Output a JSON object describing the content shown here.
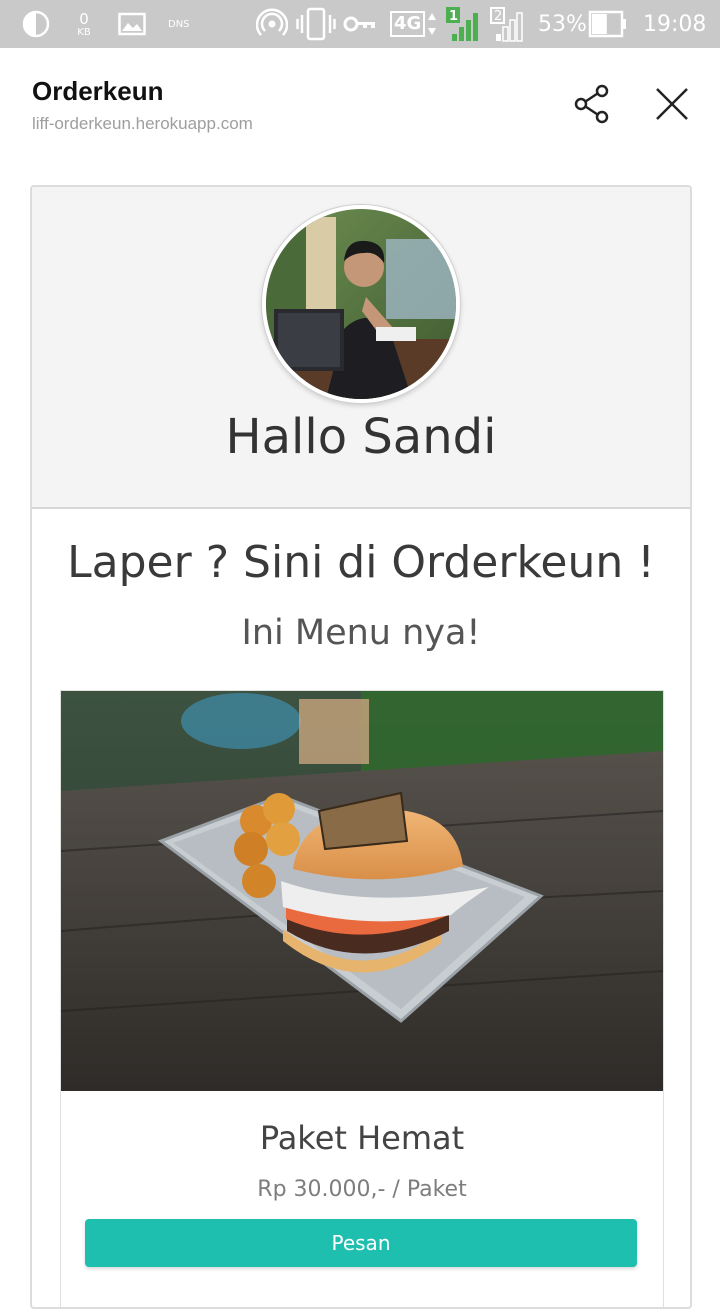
{
  "status_bar": {
    "data_speed_value": "0",
    "data_speed_unit": "KB",
    "dns_label": "DNS",
    "network_type": "4G",
    "sim1_label": "1",
    "sim2_label": "2",
    "battery_percent": "53%",
    "battery_level": 0.53,
    "time": "19:08",
    "icons": [
      "contrast-icon",
      "gallery-icon",
      "hotspot-icon",
      "vibrate-icon",
      "vpn-key-icon",
      "signal-icon",
      "battery-icon"
    ]
  },
  "header": {
    "title": "Orderkeun",
    "url": "liff-orderkeun.herokuapp.com",
    "icons": [
      "share-icon",
      "close-icon"
    ]
  },
  "profile": {
    "greeting": "Hallo Sandi"
  },
  "intro": {
    "tagline": "Laper ? Sini di Orderkeun !",
    "subline": "Ini Menu nya!"
  },
  "menu": {
    "items": [
      {
        "name": "Paket Hemat",
        "price": "Rp 30.000,- / Paket",
        "button_label": "Pesan"
      }
    ]
  },
  "colors": {
    "status_bar_bg": "#c9c9c9",
    "profile_bg": "#f4f4f4",
    "button_accent": "#1fbfb0",
    "signal_green": "#4caf50"
  }
}
